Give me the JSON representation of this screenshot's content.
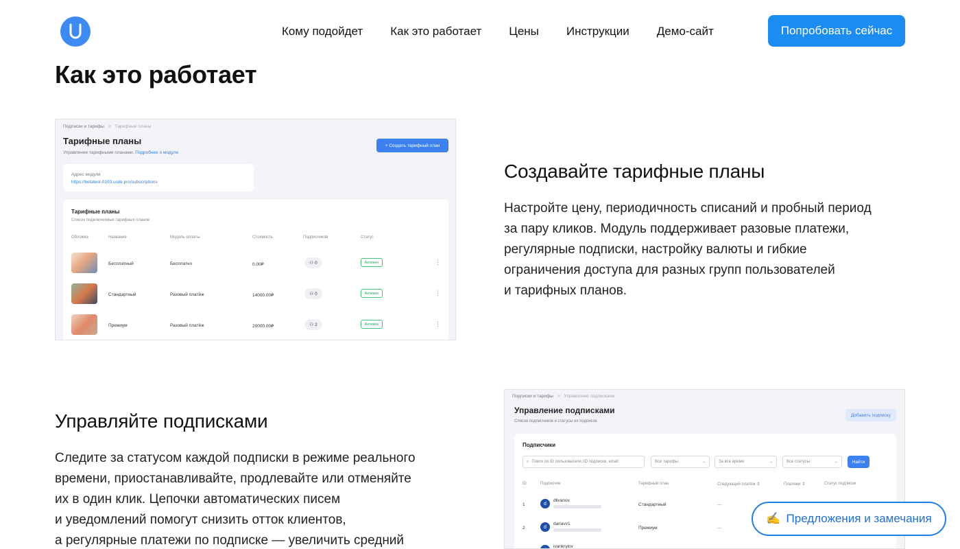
{
  "header": {
    "logo_letter": "U",
    "nav": [
      "Кому подойдет",
      "Как это работает",
      "Цены",
      "Инструкции",
      "Демо-сайт"
    ],
    "cta": "Попробовать сейчас"
  },
  "page_title": "Как это работает",
  "section1": {
    "title": "Создавайте тарифные планы",
    "text_lines": [
      "Настройте цену, периодичность списаний и пробный период",
      "за пару кликов. Модуль поддерживает разовые платежи,",
      "регулярные подписки, настройку валюты и гибкие",
      "ограничения доступа для разных групп пользователей",
      "и тарифных планов."
    ],
    "screenshot": {
      "crumb1": "Подписки и тарифы",
      "crumb_sep": ">",
      "crumb2": "Тарифные планы",
      "title": "Тарифные планы",
      "subtitle": "Управление тарифными планами.",
      "subtitle_link": "Подробнее о модуле",
      "create_button": "+  Создать тарифный план",
      "address_label": "Адрес модуля",
      "address_value": "https://betatest-0103.usite.pro/subscriptions",
      "table_title": "Тарифные планы",
      "table_subtitle": "Список подключенных тарифных планов",
      "headers": [
        "Обложка",
        "Название",
        "Модель оплаты",
        "Стоимость",
        "Подписчиков",
        "Статус"
      ],
      "rows": [
        {
          "name": "Бесплатный",
          "model": "Бесплатно",
          "price": "0.00₽",
          "subs": "0",
          "status": "Активен"
        },
        {
          "name": "Стандартный",
          "model": "Разовый платёж",
          "price": "14000.00₽",
          "subs": "0",
          "status": "Активен"
        },
        {
          "name": "Премиум",
          "model": "Разовый платёж",
          "price": "20000.00₽",
          "subs": "2",
          "status": "Активен"
        }
      ]
    }
  },
  "section2": {
    "title": "Управляйте подписками",
    "text_lines": [
      "Следите за статусом каждой подписки в режиме реального",
      "времени, приостанавливайте, продлевайте или отменяйте",
      "их в один клик. Цепочки автоматических писем",
      "и уведомлений помогут снизить отток клиентов,",
      "а регулярные платежи по подписке — увеличить средний"
    ],
    "screenshot": {
      "crumb1": "Подписки и тарифы",
      "crumb_sep": ">",
      "crumb2": "Управление подписками",
      "title": "Управление подписками",
      "subtitle": "Список подписчиков и статусы их подписок",
      "add_button": "Добавить подписку",
      "card_title": "Подписчики",
      "search_placeholder": "Поиск по ID пользователя, ID подписки, email",
      "filter_plans": "Все тарифы",
      "filter_time": "За все время",
      "filter_status": "Все статусы",
      "find_button": "Найти",
      "headers": [
        "ID",
        "Подписчик",
        "Тарифный план",
        "Следующий платёж ⇕",
        "Платежи ⇕",
        "Статус подписки"
      ],
      "rows": [
        {
          "id": "1",
          "user": "dlivanov",
          "plan": "Стандартный",
          "next": "—"
        },
        {
          "id": "2",
          "user": "dariavv1",
          "plan": "Премиум",
          "next": "—"
        },
        {
          "id": "3",
          "user": "ivankrylov",
          "plan": "",
          "next": ""
        }
      ]
    }
  },
  "feedback": {
    "icon": "✍",
    "label": "Предложения и замечания"
  }
}
